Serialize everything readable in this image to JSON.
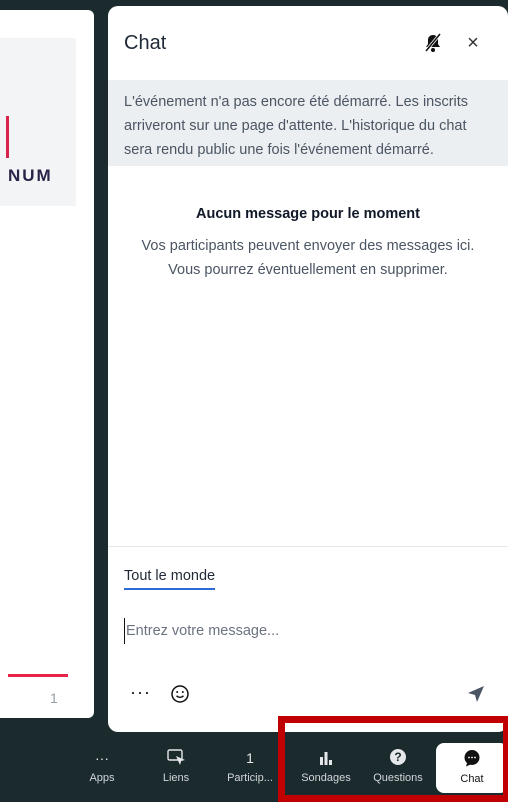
{
  "stage": {
    "slide_text": "NUM",
    "participant_count": "1"
  },
  "chat": {
    "title": "Chat",
    "mute_icon": "bell-slash-icon",
    "close_label": "×",
    "notice": "L'événement n'a pas encore été démarré. Les inscrits arriveront sur une page d'attente. L'historique du chat sera rendu public une fois l'événement démarré.",
    "empty_title": "Aucun message pour le moment",
    "empty_line1": "Vos participants peuvent envoyer des messages ici.",
    "empty_line2": "Vous pourrez éventuellement en supprimer.",
    "audience_tab": "Tout le monde",
    "input_placeholder": "Entrez votre message...",
    "more_label": "···"
  },
  "toolbar": {
    "items": [
      {
        "label": "Apps",
        "icon": "···"
      },
      {
        "label": "Liens",
        "icon": "link-icon"
      },
      {
        "label": "Particip...",
        "icon": "1"
      },
      {
        "label": "Sondages",
        "icon": "poll-icon"
      },
      {
        "label": "Questions",
        "icon": "question-icon"
      },
      {
        "label": "Chat",
        "icon": "chat-icon"
      }
    ]
  },
  "colors": {
    "accent": "#2d6bd6",
    "highlight": "#c00000",
    "background": "#1b2b2d",
    "brand_pink": "#e8234a"
  }
}
